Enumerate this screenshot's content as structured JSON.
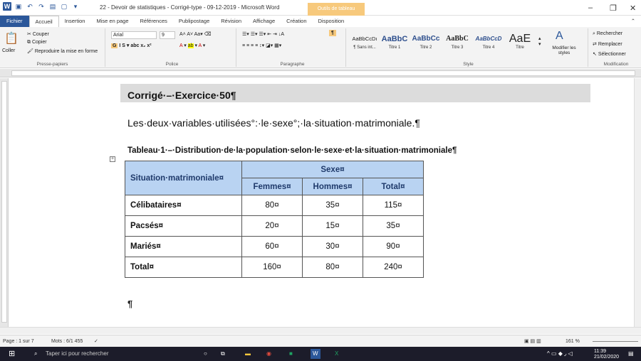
{
  "window": {
    "title": "22 - Devoir de statistiques - Corrigé-type - 09-12-2019  -  Microsoft Word",
    "context_tab": "Outils de tableau"
  },
  "tabs": [
    "Fichier",
    "Accueil",
    "Insertion",
    "Mise en page",
    "Références",
    "Publipostage",
    "Révision",
    "Affichage",
    "Création",
    "Disposition"
  ],
  "ribbon": {
    "clipboard": {
      "paste": "Coller",
      "cut": "Couper",
      "copy": "Copier",
      "format_painter": "Reproduire la mise en forme",
      "label": "Presse-papiers"
    },
    "font": {
      "name": "Arial",
      "size": "9",
      "label": "Police"
    },
    "paragraph": {
      "label": "Paragraphe"
    },
    "styles": {
      "label": "Style",
      "items": [
        {
          "preview": "AaBbCcDı",
          "name": "¶ Sans int..."
        },
        {
          "preview": "AaBbC",
          "name": "Titre 1"
        },
        {
          "preview": "AaBbCc",
          "name": "Titre 2"
        },
        {
          "preview": "AaBbC",
          "name": "Titre 3"
        },
        {
          "preview": "AaBbCcD",
          "name": "Titre 4"
        },
        {
          "preview": "AaE",
          "name": "Titre"
        }
      ],
      "modify": "Modifier les styles"
    },
    "editing": {
      "find": "Rechercher",
      "replace": "Remplacer",
      "select": "Sélectionner",
      "label": "Modification"
    }
  },
  "document": {
    "heading": "Corrigé·–·Exercice·50¶",
    "paragraph": "Les·deux·variables·utilisées°:·le·sexe°;·la·situation·matrimoniale.¶",
    "caption": "Tableau·1·–·Distribution·de·la·population·selon·le·sexe·et·la·situation·matrimoniale¶",
    "table": {
      "row_header": "Situation·matrimoniale¤",
      "group_header": "Sexe¤",
      "columns": [
        "Femmes¤",
        "Hommes¤",
        "Total¤"
      ],
      "rows": [
        {
          "label": "Célibataires¤",
          "values": [
            "80¤",
            "35¤",
            "115¤"
          ]
        },
        {
          "label": "Pacsés¤",
          "values": [
            "20¤",
            "15¤",
            "35¤"
          ]
        },
        {
          "label": "Mariés¤",
          "values": [
            "60¤",
            "30¤",
            "90¤"
          ]
        },
        {
          "label": "Total¤",
          "values": [
            "160¤",
            "80¤",
            "240¤"
          ]
        }
      ]
    },
    "trailing_mark": "¶"
  },
  "statusbar": {
    "page": "Page : 1 sur 7",
    "words": "Mots : 6/1 455",
    "zoom": "161 %"
  },
  "taskbar": {
    "search": "Taper ici pour rechercher",
    "time": "11:39",
    "date": "21/02/2020"
  }
}
